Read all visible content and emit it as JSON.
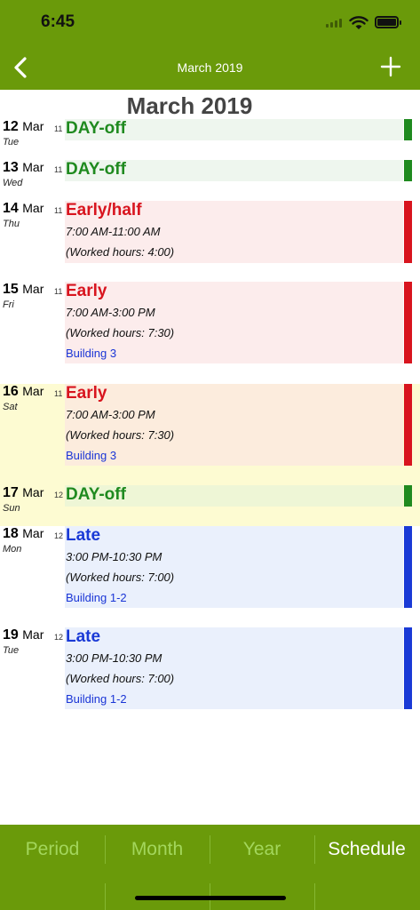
{
  "status_bar": {
    "time": "6:45"
  },
  "nav": {
    "title": "March 2019",
    "back_icon": "chevron-left-icon",
    "add_icon": "plus-icon"
  },
  "month_title": "March 2019",
  "entries": [
    {
      "day": "12",
      "month": "Mar",
      "dow": "Tue",
      "week": "11",
      "shift": "DAY-off",
      "shift_color": "#1f8a1f",
      "time": "",
      "worked": "",
      "location": ""
    },
    {
      "day": "13",
      "month": "Mar",
      "dow": "Wed",
      "week": "11",
      "shift": "DAY-off",
      "shift_color": "#1f8a1f",
      "time": "",
      "worked": "",
      "location": ""
    },
    {
      "day": "14",
      "month": "Mar",
      "dow": "Thu",
      "week": "11",
      "shift": "Early/half",
      "shift_color": "#d8141e",
      "time": "7:00 AM-11:00 AM",
      "worked": "(Worked hours: 4:00)",
      "location": ""
    },
    {
      "day": "15",
      "month": "Mar",
      "dow": "Fri",
      "week": "11",
      "shift": "Early",
      "shift_color": "#d8141e",
      "time": "7:00 AM-3:00 PM",
      "worked": "(Worked hours: 7:30)",
      "location": "Building 3"
    },
    {
      "day": "16",
      "month": "Mar",
      "dow": "Sat",
      "week": "11",
      "shift": "Early",
      "shift_color": "#d8141e",
      "time": "7:00 AM-3:00 PM",
      "worked": "(Worked hours: 7:30)",
      "location": "Building 3"
    },
    {
      "day": "17",
      "month": "Mar",
      "dow": "Sun",
      "week": "12",
      "shift": "DAY-off",
      "shift_color": "#1f8a1f",
      "time": "",
      "worked": "",
      "location": ""
    },
    {
      "day": "18",
      "month": "Mar",
      "dow": "Mon",
      "week": "12",
      "shift": "Late",
      "shift_color": "#1a3ad6",
      "time": "3:00 PM-10:30 PM",
      "worked": "(Worked hours: 7:00)",
      "location": "Building 1-2"
    },
    {
      "day": "19",
      "month": "Mar",
      "dow": "Tue",
      "week": "12",
      "shift": "Late",
      "shift_color": "#1a3ad6",
      "time": "3:00 PM-10:30 PM",
      "worked": "(Worked hours: 7:00)",
      "location": "Building 1-2"
    }
  ],
  "tabs": [
    {
      "label": "Period",
      "active": false
    },
    {
      "label": "Month",
      "active": false
    },
    {
      "label": "Year",
      "active": false
    },
    {
      "label": "Schedule",
      "active": true
    }
  ],
  "colors": {
    "brand_green": "#6a9a0a",
    "weekend_bg": "#fdfbd2",
    "dayoff_bg": "#eef6ee",
    "early_bg": "#fcecec",
    "late_bg": "#eaf0fc"
  }
}
